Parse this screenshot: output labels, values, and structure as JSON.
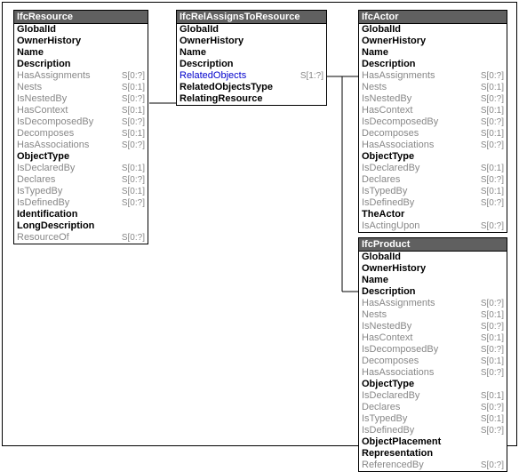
{
  "entities": {
    "ifcResource": {
      "title": "IfcResource",
      "attrs": [
        {
          "n": "GlobalId",
          "c": "",
          "s": "bold"
        },
        {
          "n": "OwnerHistory",
          "c": "",
          "s": "bold"
        },
        {
          "n": "Name",
          "c": "",
          "s": "bold"
        },
        {
          "n": "Description",
          "c": "",
          "s": "bold"
        },
        {
          "n": "HasAssignments",
          "c": "S[0:?]",
          "s": "gray"
        },
        {
          "n": "Nests",
          "c": "S[0:1]",
          "s": "gray"
        },
        {
          "n": "IsNestedBy",
          "c": "S[0:?]",
          "s": "gray"
        },
        {
          "n": "HasContext",
          "c": "S[0:1]",
          "s": "gray"
        },
        {
          "n": "IsDecomposedBy",
          "c": "S[0:?]",
          "s": "gray"
        },
        {
          "n": "Decomposes",
          "c": "S[0:1]",
          "s": "gray"
        },
        {
          "n": "HasAssociations",
          "c": "S[0:?]",
          "s": "gray"
        },
        {
          "n": "ObjectType",
          "c": "",
          "s": "bold"
        },
        {
          "n": "IsDeclaredBy",
          "c": "S[0:1]",
          "s": "gray"
        },
        {
          "n": "Declares",
          "c": "S[0:?]",
          "s": "gray"
        },
        {
          "n": "IsTypedBy",
          "c": "S[0:1]",
          "s": "gray"
        },
        {
          "n": "IsDefinedBy",
          "c": "S[0:?]",
          "s": "gray"
        },
        {
          "n": "Identification",
          "c": "",
          "s": "bold"
        },
        {
          "n": "LongDescription",
          "c": "",
          "s": "bold"
        },
        {
          "n": "ResourceOf",
          "c": "S[0:?]",
          "s": "gray"
        }
      ]
    },
    "ifcRelAssigns": {
      "title": "IfcRelAssignsToResource",
      "attrs": [
        {
          "n": "GlobalId",
          "c": "",
          "s": "bold"
        },
        {
          "n": "OwnerHistory",
          "c": "",
          "s": "bold"
        },
        {
          "n": "Name",
          "c": "",
          "s": "bold"
        },
        {
          "n": "Description",
          "c": "",
          "s": "bold"
        },
        {
          "n": "RelatedObjects",
          "c": "S[1:?]",
          "s": "link"
        },
        {
          "n": "RelatedObjectsType",
          "c": "",
          "s": "bold"
        },
        {
          "n": "RelatingResource",
          "c": "",
          "s": "bold"
        }
      ]
    },
    "ifcActor": {
      "title": "IfcActor",
      "attrs": [
        {
          "n": "GlobalId",
          "c": "",
          "s": "bold"
        },
        {
          "n": "OwnerHistory",
          "c": "",
          "s": "bold"
        },
        {
          "n": "Name",
          "c": "",
          "s": "bold"
        },
        {
          "n": "Description",
          "c": "",
          "s": "bold"
        },
        {
          "n": "HasAssignments",
          "c": "S[0:?]",
          "s": "gray"
        },
        {
          "n": "Nests",
          "c": "S[0:1]",
          "s": "gray"
        },
        {
          "n": "IsNestedBy",
          "c": "S[0:?]",
          "s": "gray"
        },
        {
          "n": "HasContext",
          "c": "S[0:1]",
          "s": "gray"
        },
        {
          "n": "IsDecomposedBy",
          "c": "S[0:?]",
          "s": "gray"
        },
        {
          "n": "Decomposes",
          "c": "S[0:1]",
          "s": "gray"
        },
        {
          "n": "HasAssociations",
          "c": "S[0:?]",
          "s": "gray"
        },
        {
          "n": "ObjectType",
          "c": "",
          "s": "bold"
        },
        {
          "n": "IsDeclaredBy",
          "c": "S[0:1]",
          "s": "gray"
        },
        {
          "n": "Declares",
          "c": "S[0:?]",
          "s": "gray"
        },
        {
          "n": "IsTypedBy",
          "c": "S[0:1]",
          "s": "gray"
        },
        {
          "n": "IsDefinedBy",
          "c": "S[0:?]",
          "s": "gray"
        },
        {
          "n": "TheActor",
          "c": "",
          "s": "bold"
        },
        {
          "n": "IsActingUpon",
          "c": "S[0:?]",
          "s": "gray"
        }
      ]
    },
    "ifcProduct": {
      "title": "IfcProduct",
      "attrs": [
        {
          "n": "GlobalId",
          "c": "",
          "s": "bold"
        },
        {
          "n": "OwnerHistory",
          "c": "",
          "s": "bold"
        },
        {
          "n": "Name",
          "c": "",
          "s": "bold"
        },
        {
          "n": "Description",
          "c": "",
          "s": "bold"
        },
        {
          "n": "HasAssignments",
          "c": "S[0:?]",
          "s": "gray"
        },
        {
          "n": "Nests",
          "c": "S[0:1]",
          "s": "gray"
        },
        {
          "n": "IsNestedBy",
          "c": "S[0:?]",
          "s": "gray"
        },
        {
          "n": "HasContext",
          "c": "S[0:1]",
          "s": "gray"
        },
        {
          "n": "IsDecomposedBy",
          "c": "S[0:?]",
          "s": "gray"
        },
        {
          "n": "Decomposes",
          "c": "S[0:1]",
          "s": "gray"
        },
        {
          "n": "HasAssociations",
          "c": "S[0:?]",
          "s": "gray"
        },
        {
          "n": "ObjectType",
          "c": "",
          "s": "bold"
        },
        {
          "n": "IsDeclaredBy",
          "c": "S[0:1]",
          "s": "gray"
        },
        {
          "n": "Declares",
          "c": "S[0:?]",
          "s": "gray"
        },
        {
          "n": "IsTypedBy",
          "c": "S[0:1]",
          "s": "gray"
        },
        {
          "n": "IsDefinedBy",
          "c": "S[0:?]",
          "s": "gray"
        },
        {
          "n": "ObjectPlacement",
          "c": "",
          "s": "bold"
        },
        {
          "n": "Representation",
          "c": "",
          "s": "bold"
        },
        {
          "n": "ReferencedBy",
          "c": "S[0:?]",
          "s": "gray"
        }
      ]
    }
  }
}
